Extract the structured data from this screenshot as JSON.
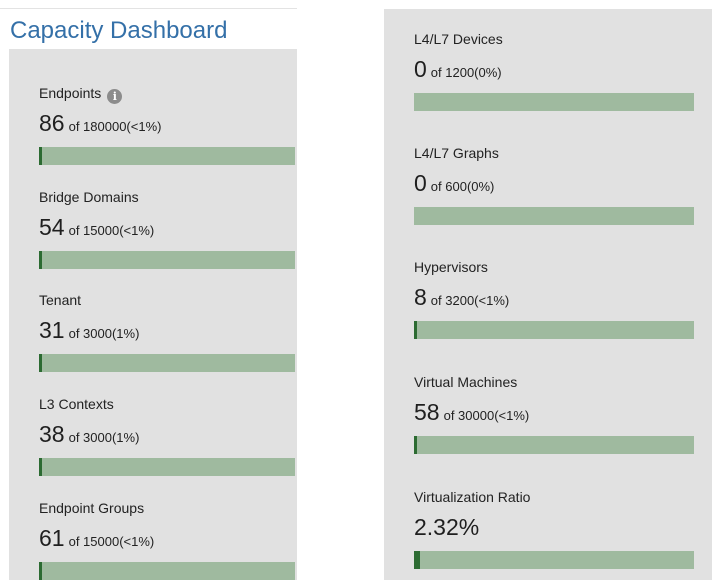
{
  "header": {
    "title": "Capacity Dashboard"
  },
  "colors": {
    "title": "#3470a8",
    "panel_background": "#e1e1e1",
    "bar_track": "#9fba9f",
    "bar_fill": "#2c6b32"
  },
  "left_panel": {
    "metrics": [
      {
        "label": "Endpoints",
        "value": "86",
        "detail": "of 180000(<1%)",
        "info_icon": "info-icon",
        "fill_fraction": 0.005
      },
      {
        "label": "Bridge Domains",
        "value": "54",
        "detail": "of 15000(<1%)",
        "fill_fraction": 0.004
      },
      {
        "label": "Tenant",
        "value": "31",
        "detail": "of 3000(1%)",
        "fill_fraction": 0.01
      },
      {
        "label": "L3 Contexts",
        "value": "38",
        "detail": "of 3000(1%)",
        "fill_fraction": 0.01
      },
      {
        "label": "Endpoint Groups",
        "value": "61",
        "detail": "of 15000(<1%)",
        "fill_fraction": 0.004
      }
    ]
  },
  "right_panel": {
    "metrics": [
      {
        "label": "L4/L7 Devices",
        "value": "0",
        "detail": "of 1200(0%)",
        "fill_fraction": 0
      },
      {
        "label": "L4/L7 Graphs",
        "value": "0",
        "detail": "of 600(0%)",
        "fill_fraction": 0
      },
      {
        "label": "Hypervisors",
        "value": "8",
        "detail": "of 3200(<1%)",
        "fill_fraction": 0.003
      },
      {
        "label": "Virtual Machines",
        "value": "58",
        "detail": "of 30000(<1%)",
        "fill_fraction": 0.002
      },
      {
        "label": "Virtualization Ratio",
        "value": "2.32%",
        "detail": "",
        "fill_fraction": 0.0232
      }
    ]
  }
}
